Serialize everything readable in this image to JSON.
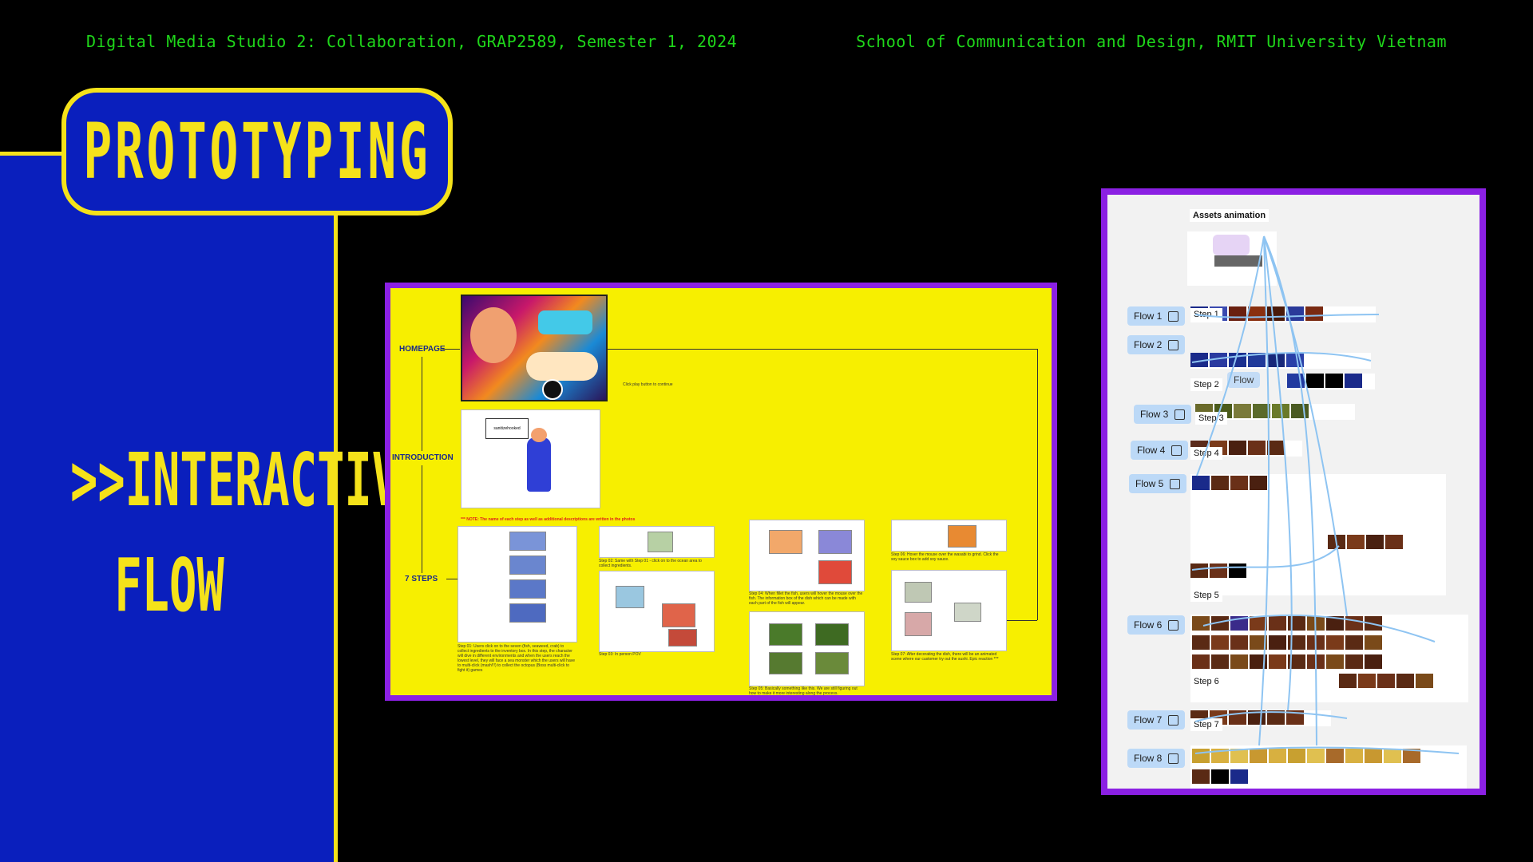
{
  "header": {
    "left": "Digital Media Studio 2: Collaboration, GRAP2589, Semester 1, 2024",
    "right": "School of Communication and Design, RMIT University Vietnam"
  },
  "title": "PROTOTYPING",
  "subtitle_line1": ">>INTERACTIVE",
  "subtitle_line2": "FLOW",
  "board": {
    "label_homepage": "HOMEPAGE",
    "label_introduction": "INTRODUCTION",
    "label_steps": "7 STEPS",
    "note_click": "Click play button to continue",
    "note_red": "*** NOTE: The name of each step as well as additional descriptions are written in the photos",
    "dialog_text": "sanitizehooked",
    "step_captions": [
      "Step 01: Users click on to the seven (fish, seaweed, crab) to collect ingredients to the inventory box. In this step, the character will dive in different environments and when the users reach the lowest level, they will face a sea monster which the users will have to multi-click (mash!!!) to collect the octopus (Boss multi-click to fight it) games",
      "Step 02: Same with Step 01 - click on to the ocean area to collect ingredients.",
      "Step 03: In person POV",
      "Step 04: When fillet the fish, users will hover the mouse over the fish. The information box of the dish which can be made with each part of the fish will appear.",
      "Step 05: Basically something like this. We are still figuring out how to make it more interesting along the process.",
      "Step 06: Hover the mouse over the wasabi to grind. Click the soy sauce box to add soy sauce.",
      "Step 07: After decorating the dish, there will be an animated scene where our customer try out the sushi. Epic reaction ***"
    ]
  },
  "flowboard": {
    "assets_label": "Assets animation",
    "flows": [
      "Flow 1",
      "Flow 2",
      "Flow 3",
      "Flow 4",
      "Flow 5",
      "Flow 6",
      "Flow 7",
      "Flow 8"
    ],
    "steps": [
      "Step 1",
      "Step 2",
      "Step 3",
      "Step 4",
      "Step 5",
      "Step 6",
      "Step 7"
    ],
    "overlay_flow_label": "Flow"
  },
  "colors": {
    "header_green": "#1fd61a",
    "panel_blue": "#0a1fbd",
    "accent_yellow": "#f5e21a",
    "frame_purple": "#8b20e3",
    "flow_blue": "#bcd9f7"
  }
}
